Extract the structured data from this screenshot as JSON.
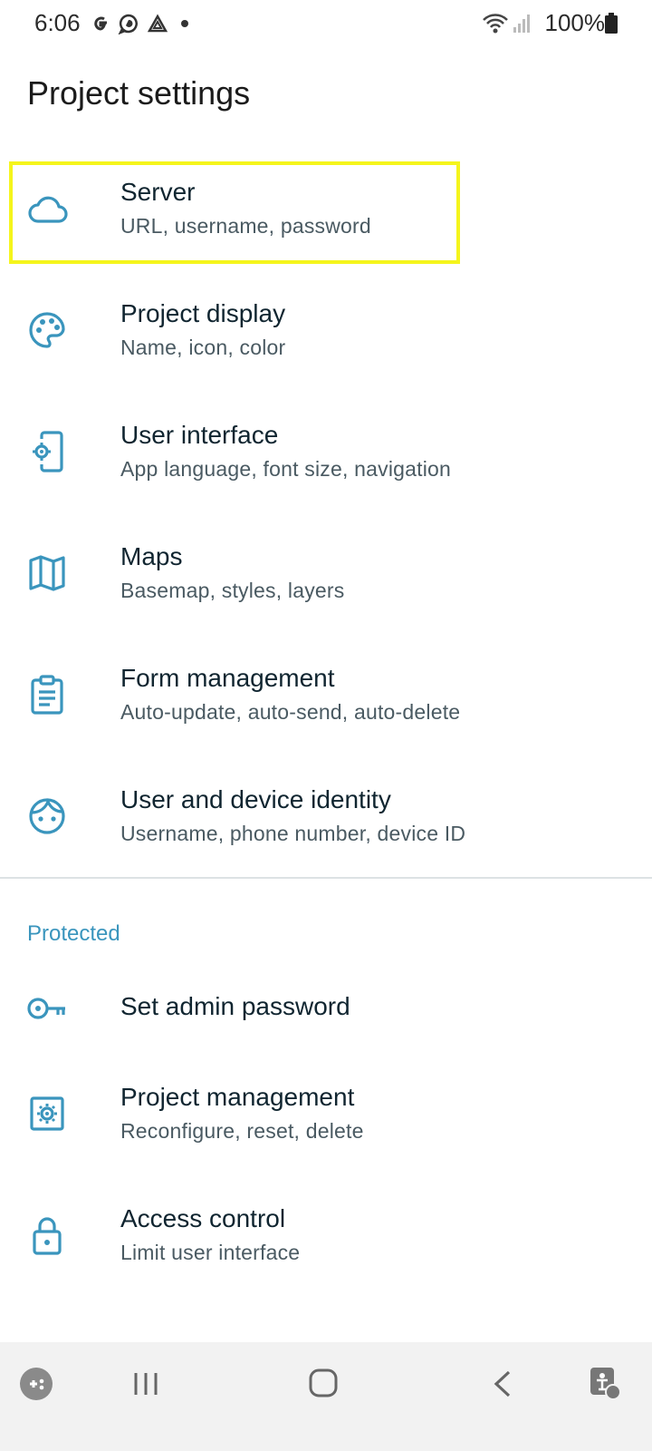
{
  "status_bar": {
    "time": "6:06",
    "battery": "100%",
    "notification_icons": [
      "google-icon",
      "chat-icon",
      "drive-icon",
      "dot-icon"
    ]
  },
  "page_title": "Project settings",
  "accent_color": "#3a95bd",
  "highlight_color": "#f5f51c",
  "items": [
    {
      "title": "Server",
      "subtitle": "URL, username, password",
      "icon": "cloud-icon"
    },
    {
      "title": "Project display",
      "subtitle": "Name, icon, color",
      "icon": "palette-icon"
    },
    {
      "title": "User interface",
      "subtitle": "App language, font size, navigation",
      "icon": "phone-settings-icon"
    },
    {
      "title": "Maps",
      "subtitle": "Basemap, styles, layers",
      "icon": "map-icon"
    },
    {
      "title": "Form management",
      "subtitle": "Auto-update, auto-send, auto-delete",
      "icon": "clipboard-icon"
    },
    {
      "title": "User and device identity",
      "subtitle": "Username, phone number, device ID",
      "icon": "face-icon"
    }
  ],
  "protected_section": {
    "header": "Protected",
    "items": [
      {
        "title": "Set admin password",
        "icon": "key-icon"
      },
      {
        "title": "Project management",
        "subtitle": "Reconfigure, reset, delete",
        "icon": "settings-box-icon"
      },
      {
        "title": "Access control",
        "subtitle": "Limit user interface",
        "icon": "lock-icon"
      }
    ]
  },
  "nav_bar": [
    "game-icon",
    "recents-icon",
    "home-icon",
    "back-icon",
    "accessibility-icon"
  ]
}
